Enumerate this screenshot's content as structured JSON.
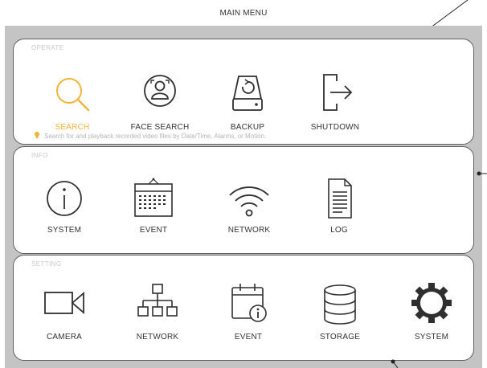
{
  "header": {
    "title": "MAIN MENU"
  },
  "colors": {
    "accent": "#f2b43a",
    "icon": "#2f2f2f",
    "panel_border": "#5e5e5e",
    "frame": "#c4c4c4",
    "section_title": "#c8c8c8",
    "hint_text": "#b5b5b5"
  },
  "sections": [
    {
      "title": "OPERATE",
      "items": [
        {
          "label": "SEARCH",
          "icon": "magnifier-icon",
          "selected": true
        },
        {
          "label": "FACE SEARCH",
          "icon": "face-search-icon"
        },
        {
          "label": "BACKUP",
          "icon": "backup-drive-icon"
        },
        {
          "label": "SHUTDOWN",
          "icon": "exit-arrow-icon"
        }
      ],
      "hint": "Search for and playback recorded video files by Date/Time, Alarms, or Motion."
    },
    {
      "title": "INFO",
      "items": [
        {
          "label": "SYSTEM",
          "icon": "info-icon"
        },
        {
          "label": "EVENT",
          "icon": "calendar-icon"
        },
        {
          "label": "NETWORK",
          "icon": "wifi-icon"
        },
        {
          "label": "LOG",
          "icon": "document-icon"
        }
      ]
    },
    {
      "title": "SETTING",
      "items": [
        {
          "label": "CAMERA",
          "icon": "video-camera-icon"
        },
        {
          "label": "NETWORK",
          "icon": "network-topology-icon"
        },
        {
          "label": "EVENT",
          "icon": "calendar-info-icon"
        },
        {
          "label": "STORAGE",
          "icon": "database-icon"
        },
        {
          "label": "SYSTEM",
          "icon": "gear-icon"
        }
      ]
    }
  ]
}
